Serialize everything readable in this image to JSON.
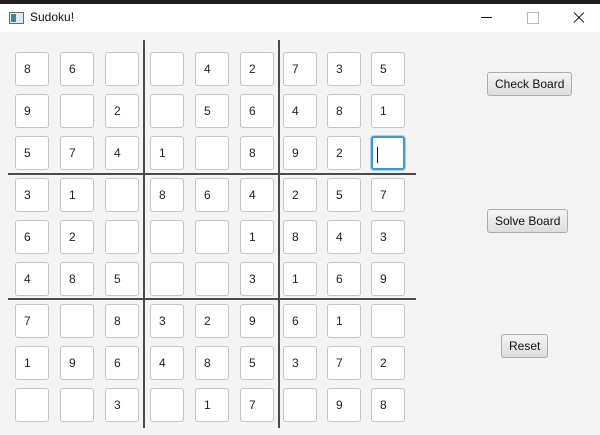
{
  "window": {
    "title": "Sudoku!"
  },
  "board": {
    "rows": [
      [
        "8",
        "6",
        "",
        "",
        "4",
        "2",
        "7",
        "3",
        "5"
      ],
      [
        "9",
        "",
        "2",
        "",
        "5",
        "6",
        "4",
        "8",
        "1"
      ],
      [
        "5",
        "7",
        "4",
        "1",
        "",
        "8",
        "9",
        "2",
        ""
      ],
      [
        "3",
        "1",
        "",
        "8",
        "6",
        "4",
        "2",
        "5",
        "7"
      ],
      [
        "6",
        "2",
        "",
        "",
        "",
        "1",
        "8",
        "4",
        "3"
      ],
      [
        "4",
        "8",
        "5",
        "",
        "",
        "3",
        "1",
        "6",
        "9"
      ],
      [
        "7",
        "",
        "8",
        "3",
        "2",
        "9",
        "6",
        "1",
        ""
      ],
      [
        "1",
        "9",
        "6",
        "4",
        "8",
        "5",
        "3",
        "7",
        "2"
      ],
      [
        "",
        "",
        "3",
        "",
        "1",
        "7",
        "",
        "9",
        "8"
      ]
    ],
    "focused_cell": {
      "row": 2,
      "col": 8
    }
  },
  "buttons": {
    "check_label": "Check Board",
    "solve_label": "Solve Board",
    "reset_label": "Reset"
  }
}
